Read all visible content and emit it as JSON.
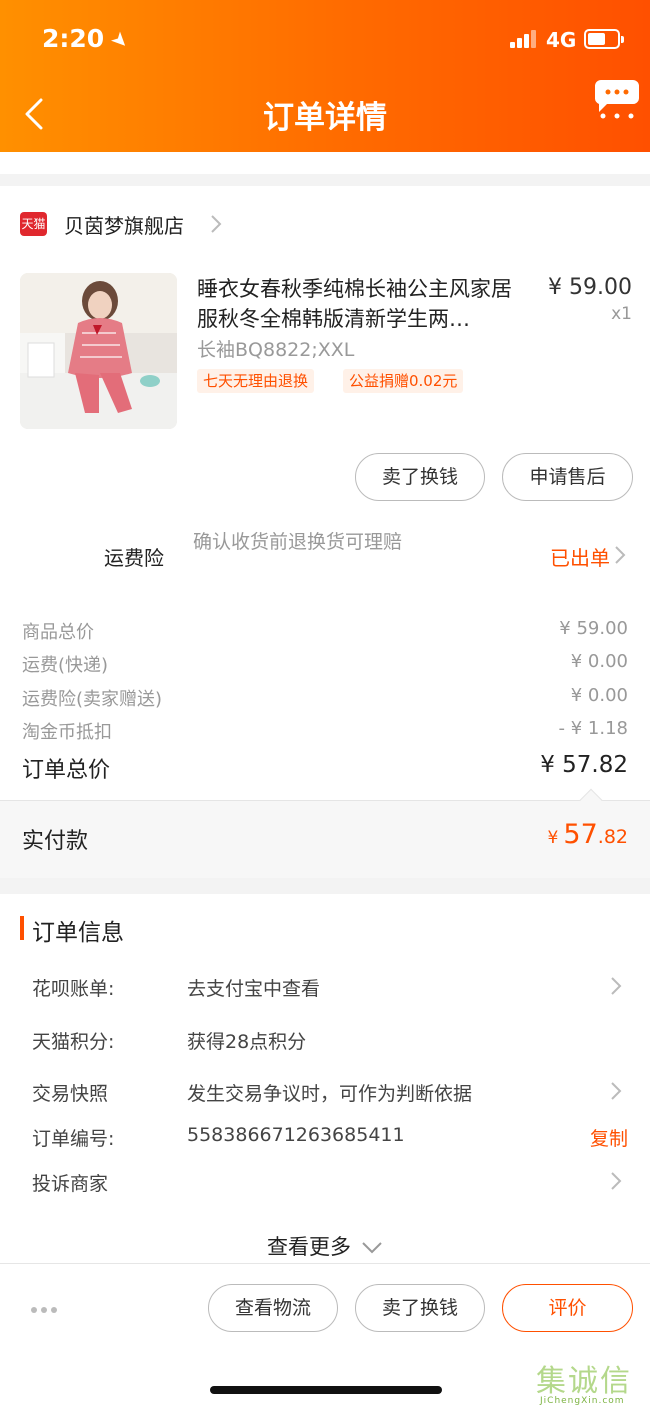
{
  "status_bar": {
    "time": "2:20",
    "network": "4G"
  },
  "nav": {
    "title": "订单详情"
  },
  "shop": {
    "badge": "天猫",
    "name": "贝茵梦旗舰店"
  },
  "product": {
    "title": "睡衣女春秋季纯棉长袖公主风家居服秋冬全棉韩版清新学生两…",
    "price": "¥ 59.00",
    "qty": "x1",
    "sku": "长袖BQ8822;XXL",
    "tags": [
      "七天无理由退换",
      "公益捐赠0.02元"
    ]
  },
  "item_actions": {
    "sell": "卖了换钱",
    "after_sale": "申请售后"
  },
  "insurance": {
    "label": "运费险",
    "desc": "确认收货前退换货可理赔",
    "status": "已出单"
  },
  "fees": [
    {
      "label": "商品总价",
      "value": "¥ 59.00"
    },
    {
      "label": "运费(快递)",
      "value": "¥ 0.00"
    },
    {
      "label": "运费险(卖家赠送)",
      "value": "¥ 0.00"
    },
    {
      "label": "淘金币抵扣",
      "value": "- ¥ 1.18"
    }
  ],
  "total": {
    "label": "订单总价",
    "value": "¥ 57.82"
  },
  "paid": {
    "label": "实付款",
    "currency": "¥",
    "integer": "57",
    "decimal": ".82"
  },
  "order_info": {
    "title": "订单信息",
    "rows": [
      {
        "label": "花呗账单:",
        "value": "去支付宝中查看"
      },
      {
        "label": "天猫积分:",
        "value": "获得28点积分"
      },
      {
        "label": "交易快照",
        "value": "发生交易争议时，可作为判断依据"
      },
      {
        "label": "订单编号:",
        "value": "558386671263685411"
      },
      {
        "label": "投诉商家",
        "value": ""
      }
    ],
    "copy": "复制",
    "see_more": "查看更多"
  },
  "bottom_actions": {
    "logistics": "查看物流",
    "sell": "卖了换钱",
    "review": "评价"
  },
  "watermark": {
    "text": "集诚信",
    "url": "JiChengXin.com"
  },
  "colors": {
    "accent": "#ff5000",
    "header_start": "#ff9000",
    "header_end": "#ff5000"
  }
}
